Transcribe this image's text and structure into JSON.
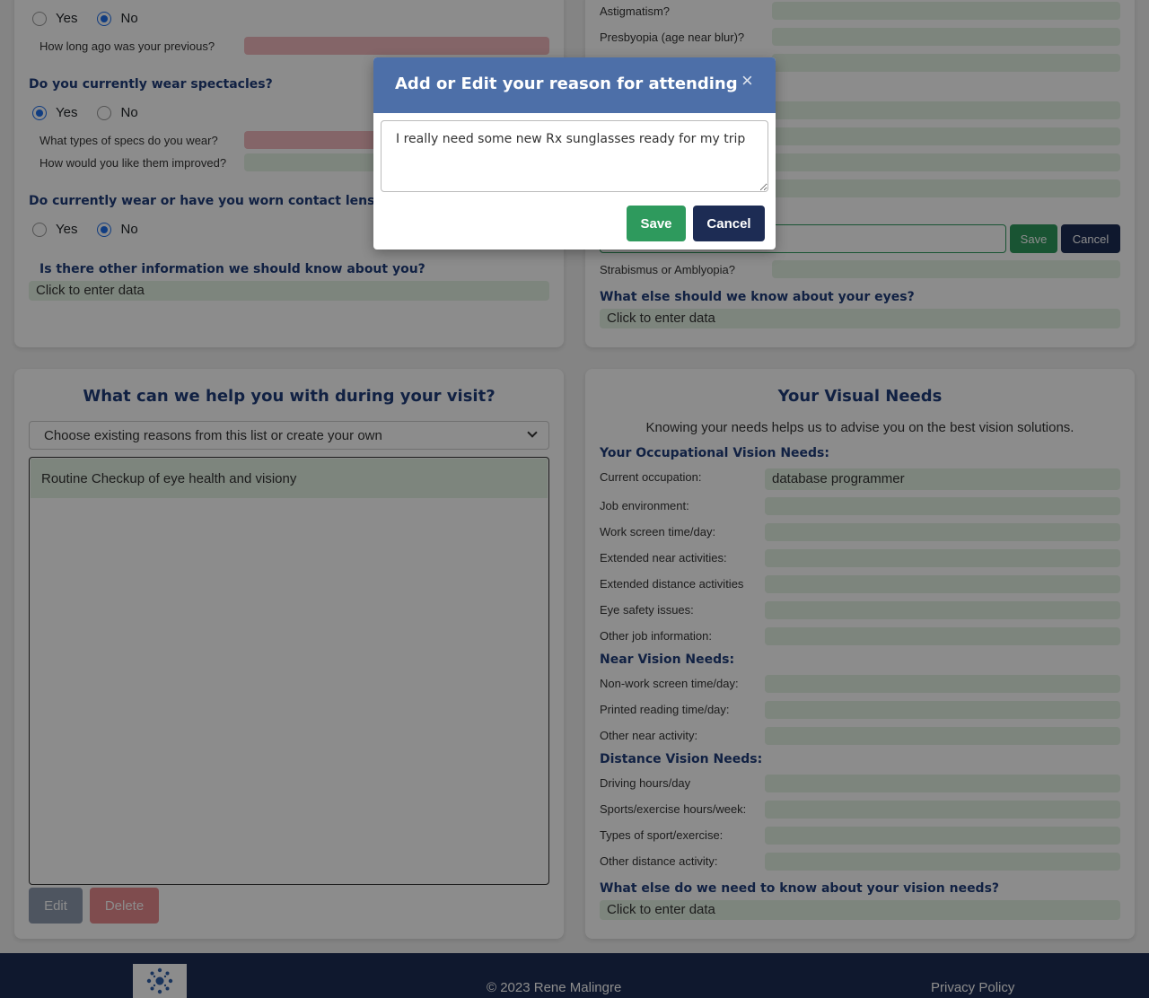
{
  "left_top": {
    "radio1": {
      "yes": "Yes",
      "no": "No"
    },
    "prev_label": "How long ago was your previous?",
    "spectacles_q": "Do you currently wear spectacles?",
    "radio2": {
      "yes": "Yes",
      "no": "No"
    },
    "specs_types_label": "What types of specs do you wear?",
    "improve_label": "How would you like them improved?",
    "contacts_q": "Do currently wear or have you worn contact lenses?",
    "radio3": {
      "yes": "Yes",
      "no": "No"
    },
    "other_info_q": "Is there other information we should know about you?",
    "other_info_value": "Click to enter data"
  },
  "right_top": {
    "astigmatism_label": "Astigmatism?",
    "presbyopia_label": "Presbyopia (age near blur)?",
    "edit_save": "Save",
    "edit_cancel": "Cancel",
    "strabismus_label": "Strabismus or Amblyopia?",
    "eyes_q": "What else should we know about your eyes?",
    "eyes_value": "Click to enter data"
  },
  "help": {
    "title": "What can we help you with during your visit?",
    "select_text": "Choose existing reasons from this list or create your own",
    "reason_item": "Routine Checkup of eye health and visiony",
    "edit_btn": "Edit",
    "delete_btn": "Delete"
  },
  "visual_needs": {
    "title": "Your Visual Needs",
    "intro": "Knowing your needs helps us to advise you on the best vision solutions.",
    "occupational_heading": "Your Occupational Vision Needs:",
    "occupation_label": "Current occupation:",
    "occupation_value": "database programmer",
    "job_env_label": "Job environment:",
    "work_screen_label": "Work screen time/day:",
    "ext_near_label": "Extended near activities:",
    "ext_dist_label": "Extended distance activities",
    "eye_safety_label": "Eye safety issues:",
    "other_job_label": "Other job information:",
    "near_heading": "Near Vision Needs:",
    "nonwork_screen_label": "Non-work screen time/day:",
    "printed_label": "Printed reading time/day:",
    "other_near_label": "Other near activity:",
    "distance_heading": "Distance Vision Needs:",
    "driving_label": "Driving hours/day",
    "sports_label": "Sports/exercise hours/week:",
    "sport_types_label": "Types of sport/exercise:",
    "other_distance_label": "Other distance activity:",
    "else_q": "What else do we need to know about your vision needs?",
    "else_value": "Click to enter data"
  },
  "footer": {
    "copyright": "© 2023 Rene Malingre",
    "privacy": "Privacy Policy"
  },
  "modal": {
    "title": "Add or Edit your reason for attending",
    "close": "×",
    "textarea_value": "I really need some new Rx sunglasses ready for my trip",
    "save": "Save",
    "cancel": "Cancel"
  }
}
